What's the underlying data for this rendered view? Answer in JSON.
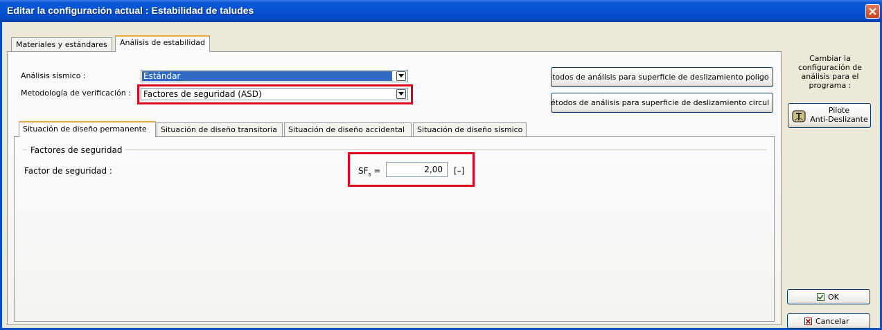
{
  "window": {
    "title": "Editar la configuración actual : Estabilidad de taludes"
  },
  "tabs": [
    "Materiales y estándares",
    "Análisis de estabilidad"
  ],
  "form": {
    "seismic_label": "Análisis sísmico :",
    "seismic_value": "Estándar",
    "method_label": "Metodología de verificación :",
    "method_value": "Factores de seguridad (ASD)"
  },
  "buttons": {
    "polygonal": "étodos de análisis para superficie de deslizamiento poligo",
    "polygonal_prefix": "t",
    "circular": "étodos de análisis para superficie de deslizamiento circul",
    "ok": "OK",
    "cancel": "Cancelar"
  },
  "design_tabs": [
    "Situación de diseño permanente",
    "Situación de diseño transitoria",
    "Situación de diseño accidental",
    "Situación de diseño sísmico"
  ],
  "safety": {
    "group_title": "Factores de seguridad",
    "factor_label": "Factor de seguridad :",
    "symbol": "SF",
    "subscript": "s",
    "equals": "=",
    "value": "2,00",
    "unit": "[–]"
  },
  "side": {
    "change_text": "Cambiar la configuración de análisis para el programa :",
    "pile_line1": "Pilote",
    "pile_line2": "Anti-Deslizante"
  },
  "colors": {
    "title_bar": "#0551d1",
    "highlight": "#e0001b",
    "tab_accent": "#f3a83a"
  }
}
